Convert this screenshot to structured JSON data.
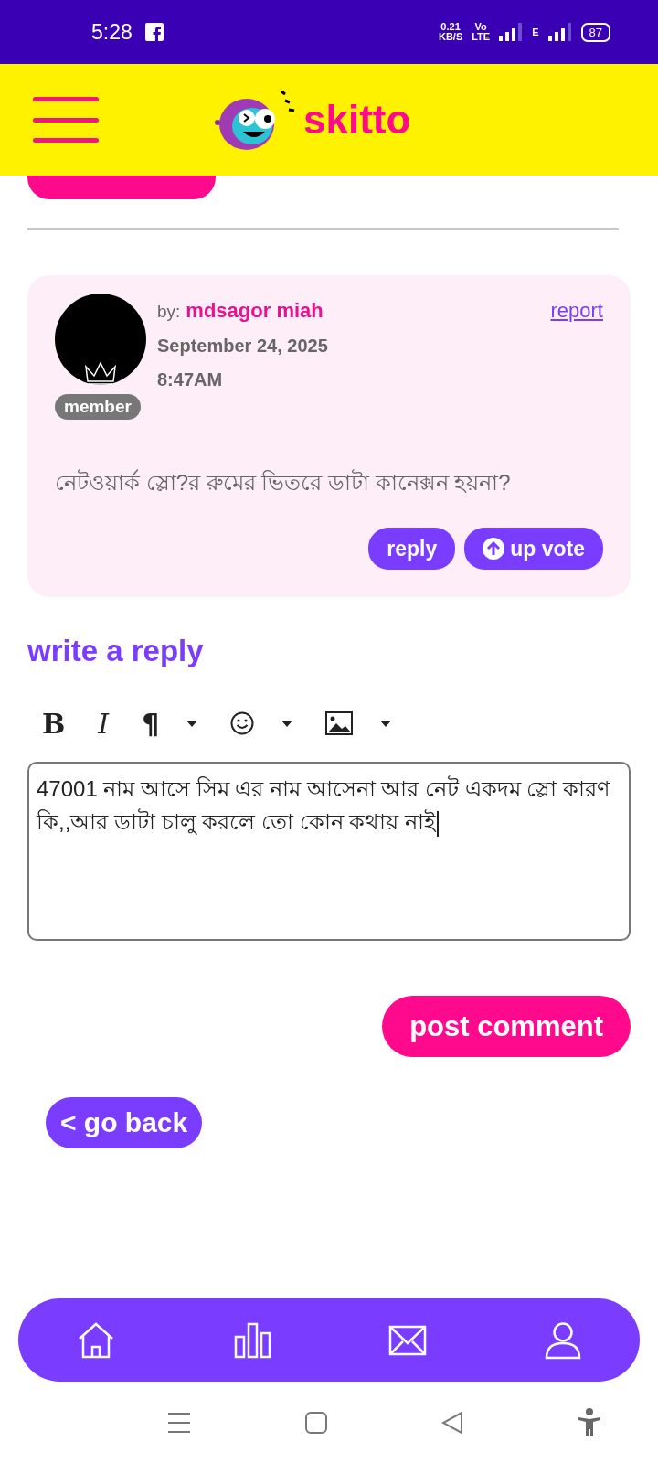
{
  "status_bar": {
    "time": "5:28",
    "speed": "0.21",
    "speed_unit": "KB/S",
    "volte": "Vo",
    "lte": "LTE",
    "network": "E",
    "battery": "87"
  },
  "header": {
    "logo_text": "skitto"
  },
  "comment": {
    "by_label": "by:",
    "author": "mdsagor miah",
    "report": "report",
    "date": "September 24, 2025",
    "time": "8:47AM",
    "badge": "member",
    "text": "নেটওয়ার্ক স্লো?র রুমের ভিতরে ডাটা কানেক্সন হয়না?",
    "actions": [
      {
        "kind": "reply",
        "label": "reply"
      },
      {
        "kind": "upvote",
        "label": "up vote"
      }
    ]
  },
  "reply_form": {
    "title": "write a reply",
    "toolbar": [
      {
        "kind": "bold",
        "label": "B",
        "dropdown": false
      },
      {
        "kind": "italic",
        "label": "I",
        "dropdown": false
      },
      {
        "kind": "paragraph",
        "label": "¶",
        "dropdown": true
      },
      {
        "kind": "emoji",
        "dropdown": true
      },
      {
        "kind": "image",
        "dropdown": true
      }
    ],
    "value": "47001 নাম আসে সিম এর নাম আসেনা আর নেট একদম স্লো কারণ কি,,আর ডাটা চালু করলে তো কোন কথায় নাই",
    "submit": "post comment"
  },
  "back_button": "< go back",
  "bottom_nav": [
    {
      "kind": "home"
    },
    {
      "kind": "stats"
    },
    {
      "kind": "mail"
    },
    {
      "kind": "profile"
    }
  ]
}
